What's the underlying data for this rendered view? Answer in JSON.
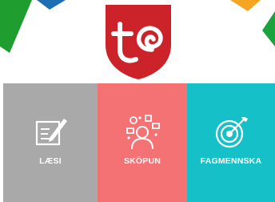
{
  "logo": {
    "icon": "municipality-shield-logo",
    "color": "#cc2229"
  },
  "decorations": {
    "colors": [
      "#1f9e2f",
      "#1c6fb3",
      "#f4a623",
      "#1aa33a"
    ]
  },
  "tiles": [
    {
      "label": "LÆSI",
      "icon": "writing-pencil-icon",
      "color": "#a9a9a9"
    },
    {
      "label": "SKÖPUN",
      "icon": "creative-person-icon",
      "color": "#f47174"
    },
    {
      "label": "FAGMENNSKA",
      "icon": "target-arrow-icon",
      "color": "#15c0c8"
    }
  ]
}
